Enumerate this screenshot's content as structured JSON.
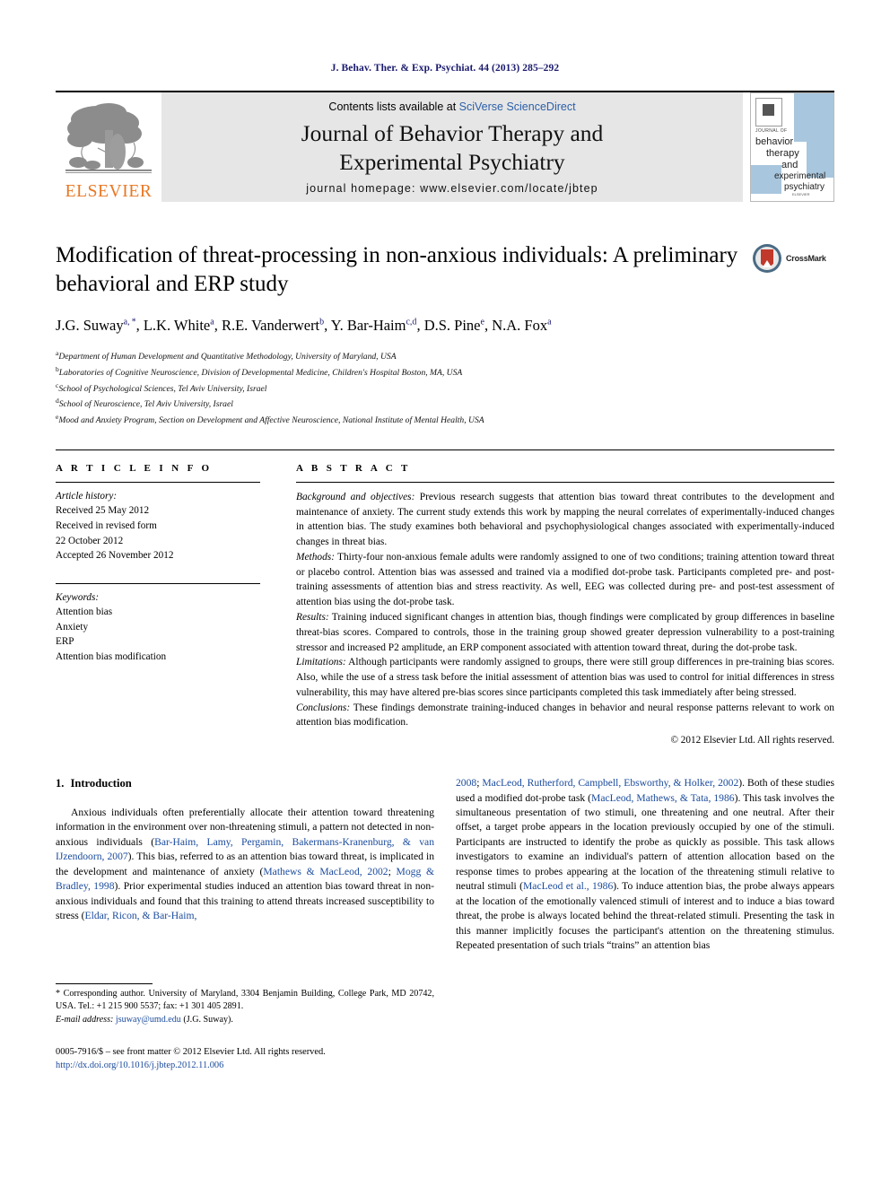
{
  "running_head": "J. Behav. Ther. & Exp. Psychiat. 44 (2013) 285–292",
  "masthead": {
    "publisher": "ELSEVIER",
    "contents_prefix": "Contents lists available at ",
    "contents_link": "SciVerse ScienceDirect",
    "journal_title_line1": "Journal of Behavior Therapy and",
    "journal_title_line2": "Experimental Psychiatry",
    "homepage": "journal homepage: www.elsevier.com/locate/jbtep",
    "cover": {
      "journal_of": "JOURNAL OF",
      "line1": "behavior",
      "line2": "therapy",
      "line3": "and",
      "line4": "experimental",
      "line5": "psychiatry",
      "footer": "ELSEVIER"
    }
  },
  "article": {
    "title": "Modification of threat-processing in non-anxious individuals: A preliminary behavioral and ERP study",
    "crossmark_label": "CrossMark",
    "authors_html": "J.G. Suway<sup>a, *</sup>, L.K. White<sup>a</sup>, R.E. Vanderwert<sup>b</sup>, Y. Bar-Haim<sup>c,d</sup>, D.S. Pine<sup>e</sup>, N.A. Fox<sup>a</sup>",
    "affiliations": [
      {
        "mark": "a",
        "text": "Department of Human Development and Quantitative Methodology, University of Maryland, USA"
      },
      {
        "mark": "b",
        "text": "Laboratories of Cognitive Neuroscience, Division of Developmental Medicine, Children's Hospital Boston, MA, USA"
      },
      {
        "mark": "c",
        "text": "School of Psychological Sciences, Tel Aviv University, Israel"
      },
      {
        "mark": "d",
        "text": "School of Neuroscience, Tel Aviv University, Israel"
      },
      {
        "mark": "e",
        "text": "Mood and Anxiety Program, Section on Development and Affective Neuroscience, National Institute of Mental Health, USA"
      }
    ]
  },
  "article_info": {
    "kicker": "A R T I C L E  I N F O",
    "history_label": "Article history:",
    "history": [
      "Received 25 May 2012",
      "Received in revised form",
      "22 October 2012",
      "Accepted 26 November 2012"
    ],
    "keywords_label": "Keywords:",
    "keywords": [
      "Attention bias",
      "Anxiety",
      "ERP",
      "Attention bias modification"
    ]
  },
  "abstract": {
    "kicker": "A B S T R A C T",
    "sections": [
      {
        "lead": "Background and objectives:",
        "text": " Previous research suggests that attention bias toward threat contributes to the development and maintenance of anxiety. The current study extends this work by mapping the neural correlates of experimentally-induced changes in attention bias. The study examines both behavioral and psychophysiological changes associated with experimentally-induced changes in threat bias."
      },
      {
        "lead": "Methods:",
        "text": " Thirty-four non-anxious female adults were randomly assigned to one of two conditions; training attention toward threat or placebo control. Attention bias was assessed and trained via a modified dot-probe task. Participants completed pre- and post-training assessments of attention bias and stress reactivity. As well, EEG was collected during pre- and post-test assessment of attention bias using the dot-probe task."
      },
      {
        "lead": "Results:",
        "text": " Training induced significant changes in attention bias, though findings were complicated by group differences in baseline threat-bias scores. Compared to controls, those in the training group showed greater depression vulnerability to a post-training stressor and increased P2 amplitude, an ERP component associated with attention toward threat, during the dot-probe task."
      },
      {
        "lead": "Limitations:",
        "text": " Although participants were randomly assigned to groups, there were still group differences in pre-training bias scores. Also, while the use of a stress task before the initial assessment of attention bias was used to control for initial differences in stress vulnerability, this may have altered pre-bias scores since participants completed this task immediately after being stressed."
      },
      {
        "lead": "Conclusions:",
        "text": " These findings demonstrate training-induced changes in behavior and neural response patterns relevant to work on attention bias modification."
      }
    ],
    "copyright": "© 2012 Elsevier Ltd. All rights reserved."
  },
  "introduction": {
    "number": "1.",
    "heading": "Introduction",
    "left_paragraph_html": "Anxious individuals often preferentially allocate their attention toward threatening information in the environment over non-threatening stimuli, a pattern not detected in non-anxious individuals (<span class=\"cite\">Bar-Haim, Lamy, Pergamin, Bakermans-Kranenburg, &amp; van IJzendoorn, 2007</span>). This bias, referred to as an attention bias toward threat, is implicated in the development and maintenance of anxiety (<span class=\"cite\">Mathews &amp; MacLeod, 2002</span>; <span class=\"cite\">Mogg &amp; Bradley, 1998</span>). Prior experimental studies induced an attention bias toward threat in non-anxious individuals and found that this training to attend threats increased susceptibility to stress (<span class=\"cite\">Eldar, Ricon, &amp; Bar-Haim,</span>",
    "right_paragraph_html": "<span class=\"cite\">2008</span>; <span class=\"cite\">MacLeod, Rutherford, Campbell, Ebsworthy, &amp; Holker, 2002</span>). Both of these studies used a modified dot-probe task (<span class=\"cite\">MacLeod, Mathews, &amp; Tata, 1986</span>). This task involves the simultaneous presentation of two stimuli, one threatening and one neutral. After their offset, a target probe appears in the location previously occupied by one of the stimuli. Participants are instructed to identify the probe as quickly as possible. This task allows investigators to examine an individual's pattern of attention allocation based on the response times to probes appearing at the location of the threatening stimuli relative to neutral stimuli (<span class=\"cite\">MacLeod et al., 1986</span>). To induce attention bias, the probe always appears at the location of the emotionally valenced stimuli of interest and to induce a bias toward threat, the probe is always located behind the threat-related stimuli. Presenting the task in this manner implicitly focuses the participant's attention on the threatening stimulus. Repeated presentation of such trials “trains” an attention bias"
  },
  "footnote": {
    "corresponding_html": "<span class=\"fn-indent\">* Corresponding author. University of Maryland, 3304 Benjamin Building, College Park, MD 20742, USA. Tel.: +1 215 900 5537; fax: +1 301 405 2891.</span>",
    "email_html": "<span class=\"fn-indent\"><span class=\"email-lead\">E-mail address:</span> <span class=\"cite\">jsuway@umd.edu</span> (J.G. Suway).</span>"
  },
  "imprint": {
    "line1": "0005-7916/$ – see front matter © 2012 Elsevier Ltd. All rights reserved.",
    "doi": "http://dx.doi.org/10.1016/j.jbtep.2012.11.006"
  }
}
